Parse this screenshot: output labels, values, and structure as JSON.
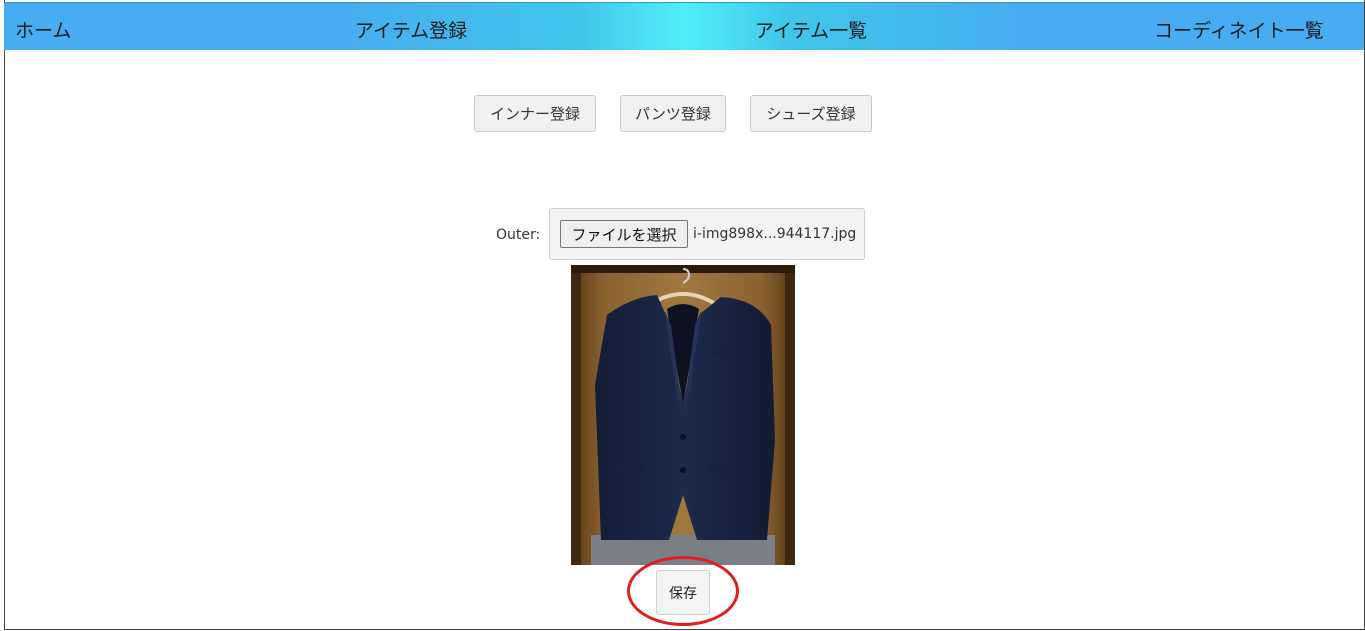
{
  "nav": {
    "home": "ホーム",
    "item_register": "アイテム登録",
    "item_list": "アイテム一覧",
    "coordinate_list": "コーディネイト一覧"
  },
  "category_buttons": {
    "inner": "インナー登録",
    "pants": "パンツ登録",
    "shoes": "シューズ登録"
  },
  "upload": {
    "label": "Outer:",
    "choose_file": "ファイルを選択",
    "file_name": "i-img898x...944117.jpg"
  },
  "save_button": "保存",
  "colors": {
    "nav_bg": "#47acf1",
    "nav_highlight": "#52eef9",
    "annotation": "#e01e1e"
  }
}
